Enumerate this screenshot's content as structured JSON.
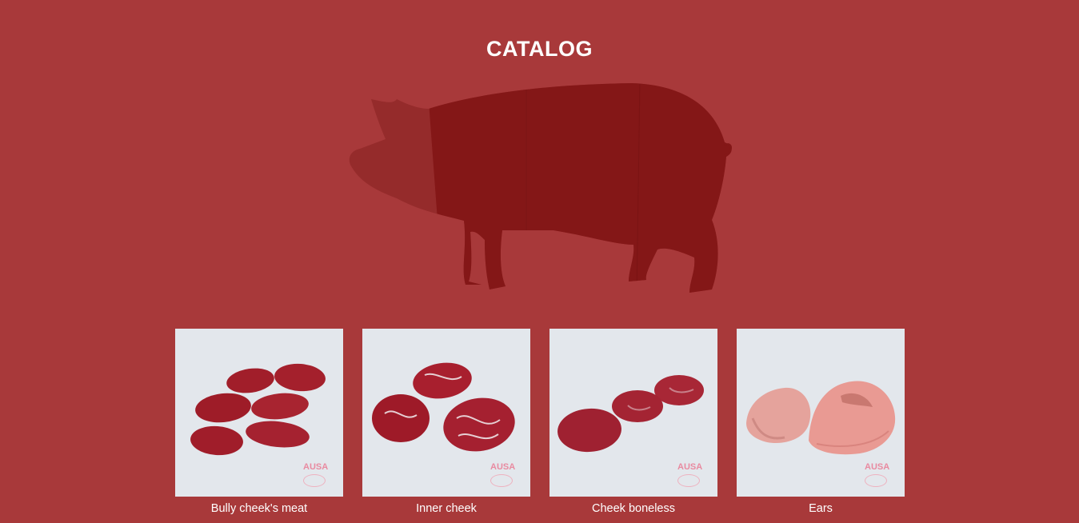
{
  "header": {
    "title": "CATALOG"
  },
  "colors": {
    "background": "#a8393a",
    "pig_head": "#952b2b",
    "pig_body": "#841717",
    "card_background": "#e3e7ec"
  },
  "pig_diagram": {
    "icon": "pig-silhouette-icon",
    "cuts": [
      "head",
      "shoulder",
      "loin",
      "ham"
    ]
  },
  "products": [
    {
      "name": "Bully cheek's meat",
      "icon": "cheek-meat-image",
      "brand": "AUSA"
    },
    {
      "name": "Inner cheek",
      "icon": "inner-cheek-image",
      "brand": "AUSA"
    },
    {
      "name": "Cheek boneless",
      "icon": "cheek-boneless-image",
      "brand": "AUSA"
    },
    {
      "name": "Ears",
      "icon": "ears-image",
      "brand": "AUSA"
    }
  ]
}
